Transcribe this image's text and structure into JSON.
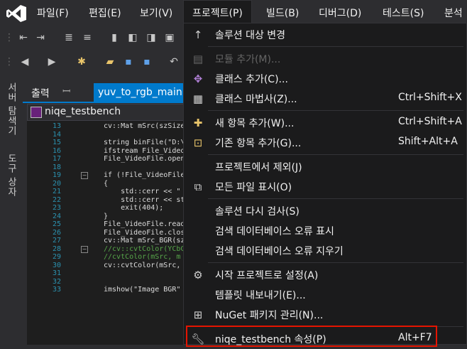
{
  "menubar": {
    "items": [
      {
        "label": "파일(F)"
      },
      {
        "label": "편집(E)"
      },
      {
        "label": "보기(V)"
      },
      {
        "label": "프로젝트(P)"
      },
      {
        "label": "빌드(B)"
      },
      {
        "label": "디버그(D)"
      },
      {
        "label": "테스트(S)"
      },
      {
        "label": "분석"
      }
    ]
  },
  "left_strip": {
    "server_explorer": "서버 탐색기",
    "toolbox": "도구 상자"
  },
  "tabs": {
    "output": "출력",
    "pin": "ꟷ",
    "document": "yuv_to_rgb_main.c"
  },
  "editor": {
    "project_name": "niqe_testbench",
    "lines": [
      {
        "num": "13",
        "code": "cv::Mat mSrc(szSize"
      },
      {
        "num": "14",
        "code": ""
      },
      {
        "num": "15",
        "code": "string binFile(\"D:\\"
      },
      {
        "num": "16",
        "code": "ifstream File_Video"
      },
      {
        "num": "17",
        "code": "File_VideoFile.open"
      },
      {
        "num": "18",
        "code": ""
      },
      {
        "num": "19",
        "code": "if (!File_VideoFile"
      },
      {
        "num": "20",
        "code": "{"
      },
      {
        "num": "21",
        "code": "    std::cerr << \""
      },
      {
        "num": "22",
        "code": "    std::cerr << st"
      },
      {
        "num": "23",
        "code": "    exit(404);"
      },
      {
        "num": "24",
        "code": "}"
      },
      {
        "num": "25",
        "code": "File_VideoFile.read"
      },
      {
        "num": "26",
        "code": "File_VideoFile.clos"
      },
      {
        "num": "27",
        "code": "cv::Mat mSrc_BGR(sz"
      },
      {
        "num": "28",
        "code": "//cv::cvtColor(YCbC"
      },
      {
        "num": "29",
        "code": "//cvtColor(mSrc, m"
      },
      {
        "num": "30",
        "code": "cv::cvtColor(mSrc, "
      },
      {
        "num": "31",
        "code": ""
      },
      {
        "num": "32",
        "code": ""
      },
      {
        "num": "33",
        "code": "imshow(\"Image BGR\""
      }
    ]
  },
  "dropdown": {
    "items": [
      {
        "label": "솔루션 대상 변경",
        "shortcut": "",
        "icon": "arrow-up-icon",
        "disabled": false
      },
      {
        "label": "모듈 추가(M)...",
        "shortcut": "",
        "icon": "module-icon",
        "disabled": true
      },
      {
        "label": "클래스 추가(C)...",
        "shortcut": "",
        "icon": "add-class-icon",
        "disabled": false
      },
      {
        "label": "클래스 마법사(Z)...",
        "shortcut": "Ctrl+Shift+X",
        "icon": "class-wizard-icon",
        "disabled": false
      },
      {
        "label": "새 항목 추가(W)...",
        "shortcut": "Ctrl+Shift+A",
        "icon": "new-item-icon",
        "disabled": false
      },
      {
        "label": "기존 항목 추가(G)...",
        "shortcut": "Shift+Alt+A",
        "icon": "existing-item-icon",
        "disabled": false
      },
      {
        "label": "프로젝트에서 제외(J)",
        "shortcut": "",
        "icon": "",
        "disabled": false
      },
      {
        "label": "모든 파일 표시(O)",
        "shortcut": "",
        "icon": "show-all-files-icon",
        "disabled": false
      },
      {
        "label": "솔루션 다시 검사(S)",
        "shortcut": "",
        "icon": "",
        "disabled": false
      },
      {
        "label": "검색 데이터베이스 오류 표시",
        "shortcut": "",
        "icon": "",
        "disabled": false
      },
      {
        "label": "검색 데이터베이스 오류 지우기",
        "shortcut": "",
        "icon": "",
        "disabled": false
      },
      {
        "label": "시작 프로젝트로 설정(A)",
        "shortcut": "",
        "icon": "gear-icon",
        "disabled": false
      },
      {
        "label": "템플릿 내보내기(E)...",
        "shortcut": "",
        "icon": "",
        "disabled": false
      },
      {
        "label": "NuGet 패키지 관리(N)...",
        "shortcut": "",
        "icon": "package-icon",
        "disabled": false
      },
      {
        "label": "niqe_testbench 속성(P)",
        "shortcut": "Alt+F7",
        "icon": "wrench-icon",
        "disabled": false
      }
    ]
  },
  "colors": {
    "accent": "#007acc",
    "highlight_border": "#e51400",
    "menu_bg": "#1b1b1c"
  }
}
